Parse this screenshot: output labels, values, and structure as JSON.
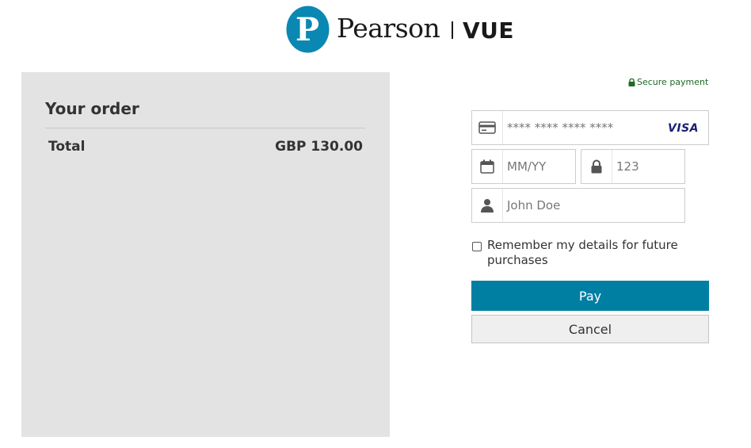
{
  "header": {
    "brand_name": "Pearson",
    "brand_product": "VUE",
    "logo_letter": "P",
    "logo_color": "#0a88b3"
  },
  "order": {
    "title": "Your order",
    "total_label": "Total",
    "total_value": "GBP 130.00"
  },
  "payment": {
    "secure_label": "Secure payment",
    "card_number_placeholder": "**** **** **** ****",
    "card_brand": "VISA",
    "expiry_placeholder": "MM/YY",
    "cvc_placeholder": "123",
    "name_placeholder": "John Doe",
    "remember_label": "Remember my details for future purchases",
    "pay_label": "Pay",
    "cancel_label": "Cancel"
  },
  "colors": {
    "accent": "#007fa3",
    "secure_green": "#1e6b25",
    "panel_bg": "#e3e3e3"
  },
  "icons": [
    "credit-card-icon",
    "calendar-icon",
    "lock-icon",
    "user-icon",
    "padlock-icon"
  ]
}
